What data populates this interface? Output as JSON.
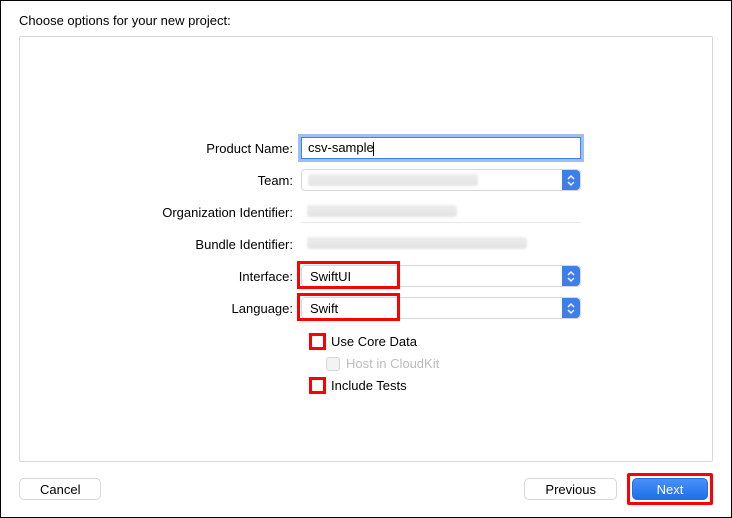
{
  "header": {
    "title": "Choose options for your new project:"
  },
  "form": {
    "productName": {
      "label": "Product Name:",
      "value": "csv-sample"
    },
    "team": {
      "label": "Team:"
    },
    "orgIdentifier": {
      "label": "Organization Identifier:"
    },
    "bundleIdentifier": {
      "label": "Bundle Identifier:"
    },
    "interface": {
      "label": "Interface:",
      "selected": "SwiftUI"
    },
    "language": {
      "label": "Language:",
      "selected": "Swift"
    },
    "useCoreData": {
      "label": "Use Core Data",
      "checked": false
    },
    "hostCloudKit": {
      "label": "Host in CloudKit",
      "checked": false,
      "disabled": true
    },
    "includeTests": {
      "label": "Include Tests",
      "checked": false
    }
  },
  "footer": {
    "cancel": "Cancel",
    "previous": "Previous",
    "next": "Next"
  }
}
